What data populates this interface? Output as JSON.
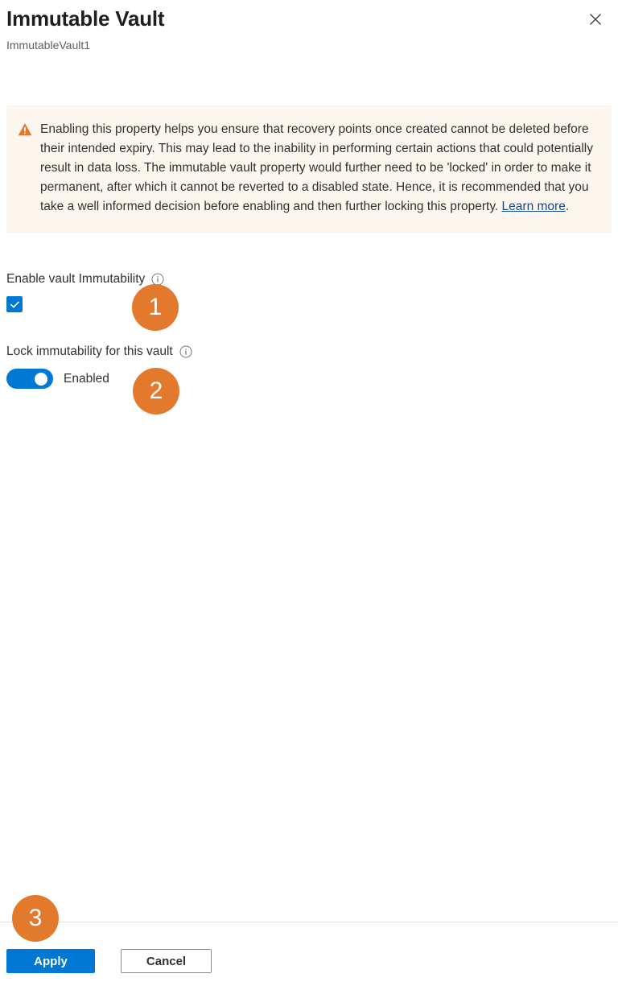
{
  "header": {
    "title": "Immutable Vault",
    "subtitle": "ImmutableVault1",
    "close_label": "Close",
    "close_icon": "close-icon"
  },
  "warning": {
    "icon": "warning-triangle-icon",
    "text": "Enabling this property helps you ensure that recovery points once created cannot be deleted before their intended expiry. This may lead to the inability in performing certain actions that could potentially result in data loss. The immutable vault property would further need to be 'locked' in order to make it permanent, after which it cannot be reverted to a disabled state. Hence, it is recommended that you take a well informed decision before enabling and then further locking this property. ",
    "link_text": "Learn more",
    "text_end": ".",
    "background_color": "#FDF6EF",
    "icon_color": "#E3792C"
  },
  "fields": {
    "enable_immutability": {
      "label": "Enable vault Immutability",
      "info_icon": "info-icon",
      "checked": true,
      "checkbox_color": "#0078D4"
    },
    "lock_immutability": {
      "label": "Lock immutability for this vault",
      "info_icon": "info-icon",
      "toggle_on": true,
      "state_label": "Enabled",
      "toggle_color": "#0078D4"
    }
  },
  "footer": {
    "apply_label": "Apply",
    "cancel_label": "Cancel",
    "primary_color": "#0078D4"
  },
  "annotations": {
    "color": "#E3792C",
    "badges": [
      {
        "number": "1"
      },
      {
        "number": "2"
      },
      {
        "number": "3"
      }
    ]
  }
}
